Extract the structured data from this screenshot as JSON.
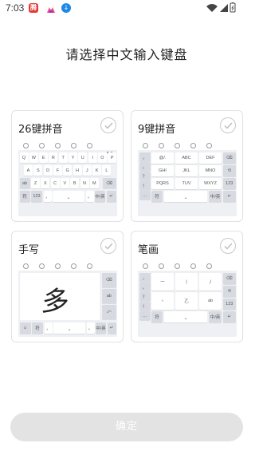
{
  "status_bar": {
    "time": "7:03",
    "app_icons": [
      "tencent-video-icon",
      "flower-app-icon",
      "download-icon"
    ],
    "status_icons": [
      "wifi-icon",
      "signal-icon",
      "battery-icon"
    ]
  },
  "page": {
    "title": "请选择中文输入键盘"
  },
  "cards": {
    "pinyin26": {
      "title": "26键拼音"
    },
    "pinyin9": {
      "title": "9键拼音"
    },
    "handwriting": {
      "title": "手写",
      "sample_char": "多"
    },
    "stroke": {
      "title": "笔画"
    }
  },
  "keyboard_preview": {
    "qwerty_rows": [
      [
        "Q",
        "W",
        "E",
        "R",
        "T",
        "Y",
        "U",
        "I",
        "O",
        "P"
      ],
      [
        "A",
        "S",
        "D",
        "F",
        "G",
        "H",
        "J",
        "K",
        "L"
      ],
      [
        "Z",
        "X",
        "C",
        "V",
        "B",
        "N",
        "M"
      ]
    ],
    "qwerty_bottom": {
      "symbols": "符",
      "num": "123",
      "comma": "，",
      "period": "。",
      "lang": "中/英"
    },
    "t9_keys": [
      "@/.",
      "ABC",
      "DEF",
      "GHI",
      "JKL",
      "MNO",
      "PQRS",
      "TUV",
      "WXYZ"
    ],
    "t9_side": [
      "，",
      "。",
      "？",
      "！",
      "…"
    ],
    "t9_bottom": {
      "symbols": "符",
      "lang": "中/英",
      "num": "123"
    },
    "hw_side": [
      "ab",
      "⌫"
    ],
    "hw_bottom": {
      "symbols": "符",
      "lang": "中/英"
    },
    "stroke_keys": [
      "一",
      "丨",
      "丿",
      "丶",
      "乙",
      "ab"
    ],
    "stroke_side": [
      "，",
      "。",
      "？",
      "！",
      "…"
    ],
    "stroke_bottom": {
      "symbols": "符",
      "lang": "中/英",
      "num": "123"
    }
  },
  "footer": {
    "confirm_label": "确定"
  }
}
